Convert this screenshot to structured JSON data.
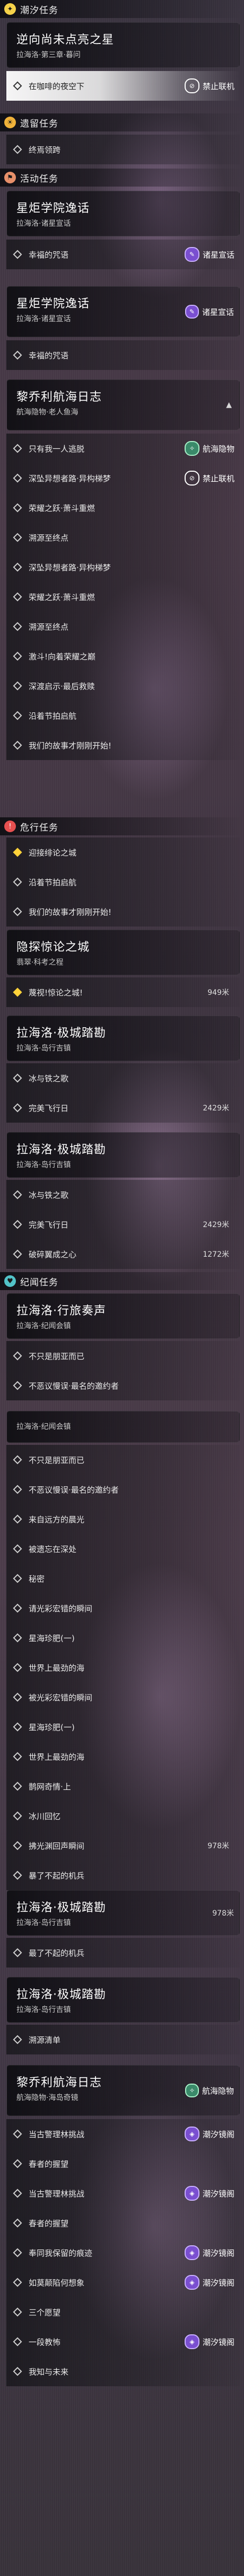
{
  "colors": {
    "trial": "#f5d24a",
    "daily": "#f0b23a",
    "event": "#e8906a",
    "danger": "#e65050",
    "companion": "#52c3c8",
    "selected": "#ffffff",
    "accent_yellow": "#ffd23a"
  },
  "sections": {
    "trial": {
      "icon": "star-icon",
      "label": "潮汐任务"
    },
    "daily": {
      "icon": "sun-icon",
      "label": "遗留任务"
    },
    "event": {
      "icon": "flag-icon",
      "label": "活动任务"
    },
    "danger": {
      "icon": "warning-icon",
      "label": "危行任务"
    },
    "companion": {
      "icon": "heart-icon",
      "label": "纪闻任务"
    }
  },
  "blocks": {
    "p1": {
      "title": "逆向尚未点亮之星",
      "sub": "拉海洛·第三章·暮问"
    },
    "p1_task": {
      "text": "在咖啡的夜空下",
      "badge": "禁止联机"
    },
    "daily_task": {
      "text": "终焉领跨"
    },
    "p2": {
      "title": "星炬学院逸话",
      "sub": "拉海洛·诸星宣话"
    },
    "p2_task": {
      "text": "幸福的咒语",
      "badge": "诸星宣话"
    },
    "p3": {
      "title": "星炬学院逸话",
      "sub": "拉海洛·诸星宣话",
      "badge": "诸星宣话"
    },
    "p3_tasks": [
      {
        "text": "幸福的咒语"
      }
    ],
    "p4": {
      "title": "黎乔利航海日志",
      "sub": "航海隐物·老人鱼海"
    },
    "p4_tasks": [
      {
        "text": "只有我一人逃脱",
        "badge": "航海隐物"
      },
      {
        "text": "深坠异想者路·异构梯梦",
        "badge": "禁止联机"
      },
      {
        "text": "荣耀之跃·萧斗重燃"
      },
      {
        "text": "溯源至终点"
      },
      {
        "text": "深坠异想者路·异构梯梦"
      },
      {
        "text": "荣耀之跃·萧斗重燃"
      },
      {
        "text": "溯源至终点"
      },
      {
        "text": "激斗!向着荣耀之巅"
      },
      {
        "text": "深渡启示·最后救赎"
      },
      {
        "text": "沿着节拍启航"
      },
      {
        "text": "我们的故事才刚刚开始!"
      }
    ],
    "danger_tasks": [
      {
        "text": "迎接绯论之城"
      },
      {
        "text": "沿着节拍启航"
      },
      {
        "text": "我们的故事才刚刚开始!"
      }
    ],
    "p5": {
      "title": "隐探惊论之城",
      "sub": "翡翠·科考之程"
    },
    "p5_task": {
      "text": "蔑视!惊论之城!",
      "dist": "949米"
    },
    "p6": {
      "title": "拉海洛·极城踏勘",
      "sub": "拉海洛·岛行吉镇"
    },
    "p6_tasks": [
      {
        "text": "冰与铁之歌"
      },
      {
        "text": "完美飞行日",
        "dist": "2429米"
      }
    ],
    "p7": {
      "title": "拉海洛·极城踏勘",
      "sub": "拉海洛·岛行吉镇"
    },
    "p7_tasks": [
      {
        "text": "冰与铁之歌"
      },
      {
        "text": "完美飞行日",
        "dist": "2429米"
      },
      {
        "text": "破碎翼成之心",
        "dist": "1272米"
      }
    ],
    "p8": {
      "title": "拉海洛·行旅奏声",
      "sub": "拉海洛·纪闻会镇"
    },
    "p8_tasks": [
      {
        "text": "不只是朋亚而已"
      },
      {
        "text": "不恶议慢误·最名的邀约者"
      }
    ],
    "p9": {
      "title": "拉海洛·纪闻会镇",
      "sub": ""
    },
    "p9_tasks": [
      {
        "text": "不只是朋亚而已"
      },
      {
        "text": "不恶议慢误·最名的邀约者"
      },
      {
        "text": "来自远方的晨光"
      },
      {
        "text": "被遗忘在深处"
      },
      {
        "text": "秘密"
      },
      {
        "text": "请光彩宏错的瞬间"
      },
      {
        "text": "星海珍肥(一)"
      },
      {
        "text": "世界上最劲的海"
      },
      {
        "text": "被光彩宏错的瞬间"
      },
      {
        "text": "星海珍肥(一)"
      },
      {
        "text": "世界上最劲的海"
      },
      {
        "text": "鹊网奇情·上"
      },
      {
        "text": "冰川回忆"
      },
      {
        "text": "拂光渊回声瞬间",
        "dist": "978米"
      },
      {
        "text": "暴了不起的机兵"
      }
    ],
    "p10": {
      "title": "拉海洛·极城踏勘",
      "sub": "拉海洛·岛行吉镇",
      "dist": "978米"
    },
    "p10_tasks": [
      {
        "text": "最了不起的机兵"
      }
    ],
    "p11": {
      "title": "拉海洛·极城踏勘",
      "sub": "拉海洛·岛行吉镇"
    },
    "p11_tasks": [
      {
        "text": "溯源清单"
      }
    ],
    "p12": {
      "title": "黎乔利航海日志",
      "sub": "航海隐物·海岛奇镜",
      "badge": "航海隐物"
    },
    "p12_tasks": [
      {
        "text": "当古警理林挑战",
        "badge": "潮汐镜阁"
      },
      {
        "text": "春者的握望"
      },
      {
        "text": "当古警理林挑战",
        "badge": "潮汐镜阁"
      },
      {
        "text": "春者的握望"
      },
      {
        "text": "奉同我保留的痕迹",
        "badge": "潮汐镜阁"
      },
      {
        "text": "如莫颠陷何想象",
        "badge": "潮汐镜阁"
      },
      {
        "text": "三个愿望"
      },
      {
        "text": "一段教怖",
        "badge": "潮汐镜阁"
      },
      {
        "text": "我知与未来"
      }
    ]
  }
}
